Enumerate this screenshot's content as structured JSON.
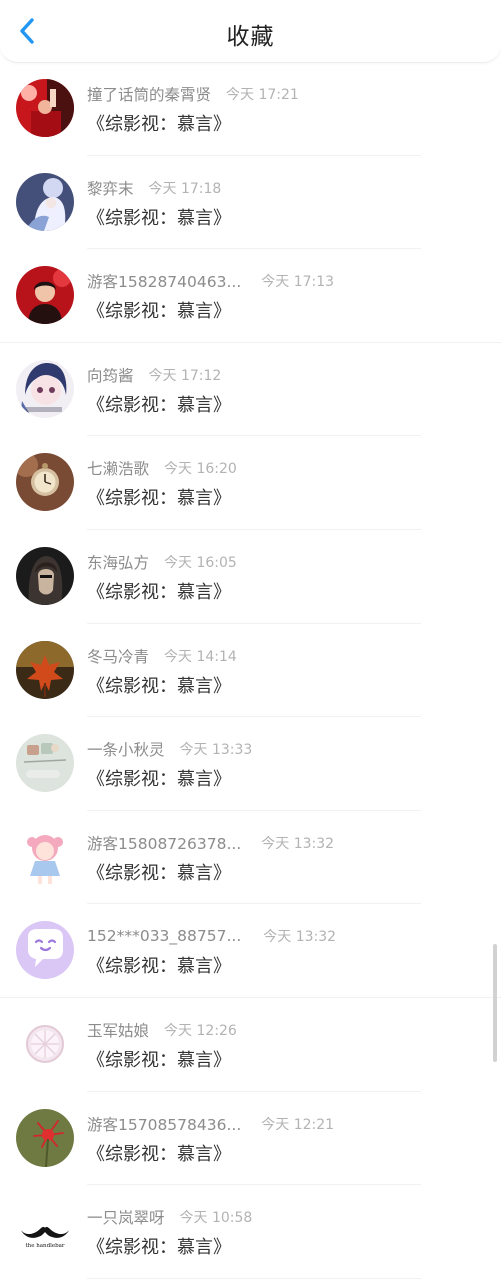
{
  "header": {
    "title": "收藏",
    "back_icon": "chevron-left-icon",
    "accent_color": "#2196F3"
  },
  "favorites": [
    {
      "nickname": "撞了话筒的秦霄贤",
      "time": "今天 17:21",
      "book": "《综影视：慕言》",
      "avatar": "avatar-red-stage"
    },
    {
      "nickname": "黎弈末",
      "time": "今天 17:18",
      "book": "《综影视：慕言》",
      "avatar": "avatar-anime-white-hair"
    },
    {
      "nickname": "游客15828740463...",
      "time": "今天 17:13",
      "book": "《综影视：慕言》",
      "avatar": "avatar-red-portrait"
    },
    {
      "nickname": "向筠酱",
      "time": "今天 17:12",
      "book": "《综影视：慕言》",
      "avatar": "avatar-anime-girl"
    },
    {
      "nickname": "七濑浩歌",
      "time": "今天 16:20",
      "book": "《综影视：慕言》",
      "avatar": "avatar-pocket-watch"
    },
    {
      "nickname": "东海弘方",
      "time": "今天 16:05",
      "book": "《综影视：慕言》",
      "avatar": "avatar-dark-portrait"
    },
    {
      "nickname": "冬马冷青",
      "time": "今天 14:14",
      "book": "《综影视：慕言》",
      "avatar": "avatar-autumn-leaf"
    },
    {
      "nickname": "一条小秋灵",
      "time": "今天 13:33",
      "book": "《综影视：慕言》",
      "avatar": "avatar-pale-sketch"
    },
    {
      "nickname": "游客15808726378...",
      "time": "今天 13:32",
      "book": "《综影视：慕言》",
      "avatar": "avatar-pink-cartoon-girl"
    },
    {
      "nickname": "152***033_88757...",
      "time": "今天 13:32",
      "book": "《综影视：慕言》",
      "avatar": "avatar-purple-chat-bubble"
    },
    {
      "nickname": "玉军姑娘",
      "time": "今天 12:26",
      "book": "《综影视：慕言》",
      "avatar": "avatar-citrus-slice"
    },
    {
      "nickname": "游客15708578436...",
      "time": "今天 12:21",
      "book": "《综影视：慕言》",
      "avatar": "avatar-red-spider-lily"
    },
    {
      "nickname": "一只岚翠呀",
      "time": "今天 10:58",
      "book": "《综影视：慕言》",
      "avatar": "avatar-mustache"
    }
  ],
  "mustache_caption": "the handlebar",
  "colors": {
    "nickname": "#8c8c8c",
    "time": "#b3b3b3",
    "title": "#333333",
    "divider": "#f1f1f1"
  }
}
